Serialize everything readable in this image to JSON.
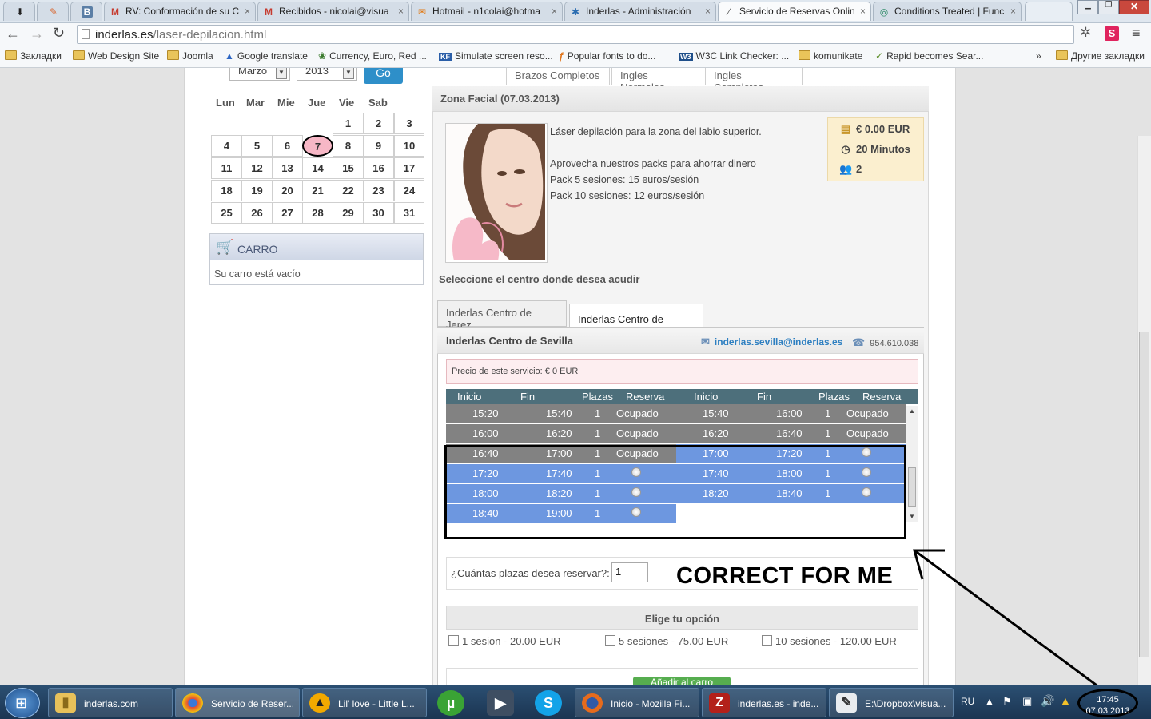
{
  "browser": {
    "tabs": [
      {
        "label": "",
        "icon": "download-arrow-icon"
      },
      {
        "label": "",
        "icon": "feather-icon"
      },
      {
        "label": "",
        "icon": "vk-icon"
      },
      {
        "label": "RV: Conformación de su C",
        "icon": "gmail-icon"
      },
      {
        "label": "Recibidos - nicolai@visua",
        "icon": "gmail-icon"
      },
      {
        "label": "Hotmail - n1colai@hotma",
        "icon": "hotmail-icon"
      },
      {
        "label": "Inderlas - Administración",
        "icon": "joomla-icon"
      },
      {
        "label": "Servicio de Reservas Onlin",
        "icon": "page-icon",
        "active": true
      },
      {
        "label": "Conditions Treated | Func",
        "icon": "page-icon"
      }
    ],
    "url_host": "inderlas.es",
    "url_path": "/laser-depilacion.html",
    "bookmarks": [
      "Закладки",
      "Web Design Site",
      "Joomla",
      "Google translate",
      "Currency, Euro, Red ...",
      "Simulate screen reso...",
      "Popular fonts to do...",
      "W3C Link Checker: ...",
      "komunikate",
      "Rapid becomes Sear..."
    ],
    "bookmarks_more": "»",
    "other_bookmarks": "Другие закладки"
  },
  "calendar": {
    "month_select": "Marzo",
    "year_select": "2013",
    "go_label": "Go",
    "weekdays": [
      "Lun",
      "Mar",
      "Mie",
      "Jue",
      "Vie",
      "Sab"
    ],
    "rows": [
      [
        "",
        "",
        "",
        "",
        "1",
        "2",
        "3"
      ],
      [
        "4",
        "5",
        "6",
        "7",
        "8",
        "9",
        "10"
      ],
      [
        "11",
        "12",
        "13",
        "14",
        "15",
        "16",
        "17"
      ],
      [
        "18",
        "19",
        "20",
        "21",
        "22",
        "23",
        "24"
      ],
      [
        "25",
        "26",
        "27",
        "28",
        "29",
        "30",
        "31"
      ]
    ],
    "today": "7"
  },
  "cart": {
    "title": "CARRO",
    "empty_text": "Su carro está vacío"
  },
  "service_tabs": [
    "Brazos Completos",
    "Ingles Normales",
    "Ingles Completas"
  ],
  "service": {
    "title": "Zona Facial (07.03.2013)",
    "description": [
      "Láser depilación para la zona del labio superior.",
      "Aprovecha nuestros packs para ahorrar dinero",
      "Pack 5 sesiones: 15 euros/sesión",
      "Pack 10 sesiones: 12 euros/sesión"
    ],
    "price": "€ 0.00 EUR",
    "duration": "20 Minutos",
    "places": "2"
  },
  "center_select_label": "Seleccione el centro donde desea acudir",
  "centers": [
    "Inderlas Centro de Jerez",
    "Inderlas Centro de Sevilla"
  ],
  "active_center": {
    "name": "Inderlas Centro de Sevilla",
    "email": "inderlas.sevilla@inderlas.es",
    "phone": "954.610.038",
    "price_note": "Precio de este servicio: € 0 EUR"
  },
  "slots_headers": [
    "Inicio",
    "Fin",
    "Plazas",
    "Reserva"
  ],
  "slots_left": [
    {
      "start": "15:20",
      "end": "15:40",
      "places": "1",
      "status": "Ocupado"
    },
    {
      "start": "16:00",
      "end": "16:20",
      "places": "1",
      "status": "Ocupado"
    },
    {
      "start": "16:40",
      "end": "17:00",
      "places": "1",
      "status": "Ocupado"
    },
    {
      "start": "17:20",
      "end": "17:40",
      "places": "1",
      "status": ""
    },
    {
      "start": "18:00",
      "end": "18:20",
      "places": "1",
      "status": ""
    },
    {
      "start": "18:40",
      "end": "19:00",
      "places": "1",
      "status": ""
    }
  ],
  "slots_right": [
    {
      "start": "15:40",
      "end": "16:00",
      "places": "1",
      "status": "Ocupado"
    },
    {
      "start": "16:20",
      "end": "16:40",
      "places": "1",
      "status": "Ocupado"
    },
    {
      "start": "17:00",
      "end": "17:20",
      "places": "1",
      "status": ""
    },
    {
      "start": "17:40",
      "end": "18:00",
      "places": "1",
      "status": ""
    },
    {
      "start": "18:20",
      "end": "18:40",
      "places": "1",
      "status": ""
    }
  ],
  "quantity": {
    "label": "¿Cuántas plazas desea reservar?:",
    "value": "1"
  },
  "annotation": "CORRECT FOR ME",
  "options": {
    "title": "Elige tu opción",
    "items": [
      "1 sesion - 20.00 EUR",
      "5 sesiones - 75.00 EUR",
      "10 sesiones - 120.00 EUR"
    ]
  },
  "add_button": "Añadir al carro",
  "taskbar": {
    "items": [
      {
        "label": "inderlas.com",
        "icon": "folder-icon"
      },
      {
        "label": "Servicio de Reser...",
        "icon": "chrome-icon"
      },
      {
        "label": "Lil' love - Little L...",
        "icon": "aimp-icon"
      },
      {
        "label": "",
        "icon": "utorrent-icon"
      },
      {
        "label": "",
        "icon": "movie-maker-icon"
      },
      {
        "label": "",
        "icon": "skype-icon"
      },
      {
        "label": "Inicio - Mozilla Fi...",
        "icon": "firefox-icon"
      },
      {
        "label": "inderlas.es - inde...",
        "icon": "filezilla-icon"
      },
      {
        "label": "E:\\Dropbox\\visua...",
        "icon": "notepad-icon"
      }
    ],
    "lang": "RU",
    "time": "17:45",
    "date": "07.03.2013"
  },
  "colors": {
    "occupied_row": "#828282",
    "free_row": "#6d97e0",
    "slot_header": "#4d6f7b",
    "today_highlight": "#f7b7c6",
    "info_box": "#fbefcf"
  }
}
